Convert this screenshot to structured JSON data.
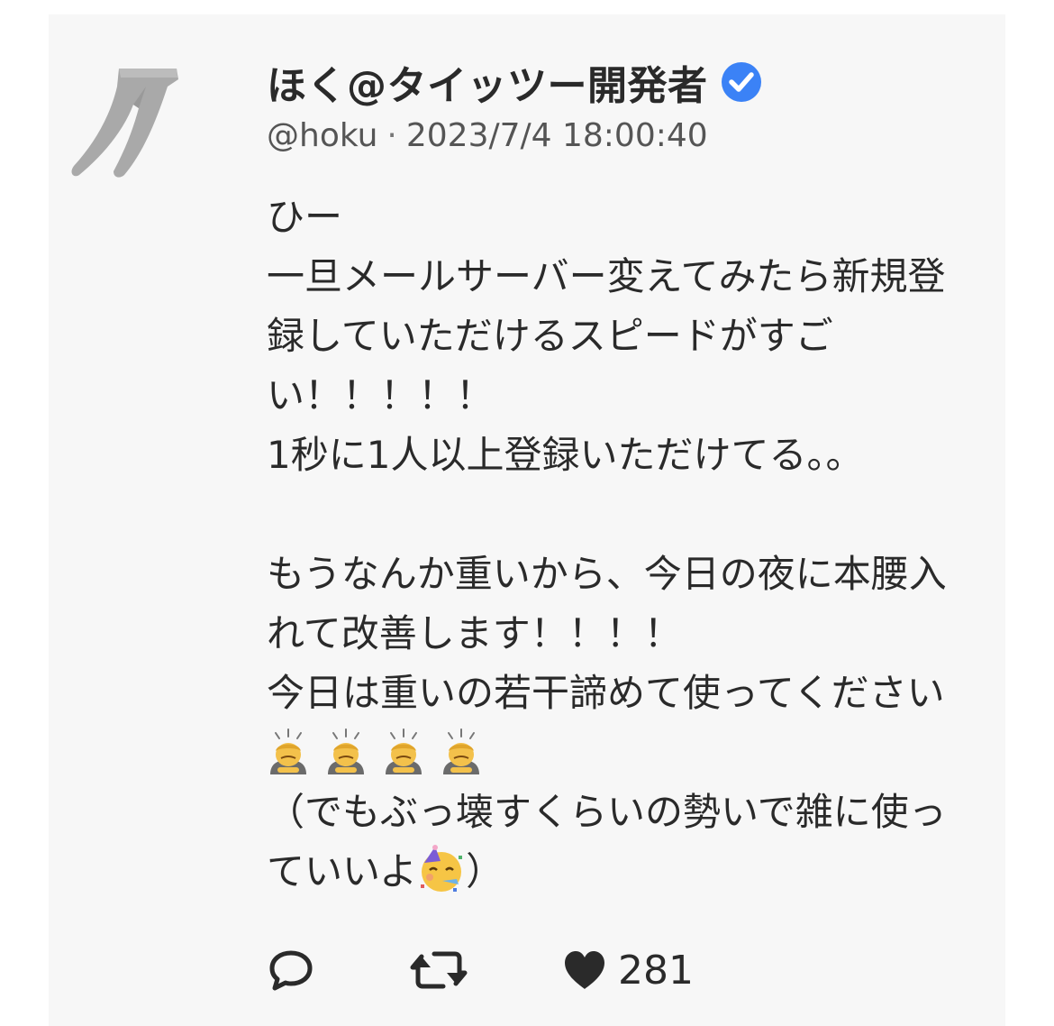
{
  "post": {
    "display_name": "ほく@タイッツー開発者",
    "verified_icon": "verified-check-icon",
    "handle": "@hoku",
    "separator": "·",
    "timestamp": "2023/7/4 18:00:40",
    "body_lines": [
      "ひー",
      "一旦メールサーバー変えてみたら新規登",
      "録していただけるスピードがすご",
      "い！！！！！",
      "1秒に1人以上登録いただけてる。。",
      "",
      "もうなんか重いから、今日の夜に本腰入",
      "れて改善します！！！！",
      "今日は重いの若干諦めて使ってください"
    ],
    "emoji_row": [
      "person-bowing-icon",
      "person-bowing-icon",
      "person-bowing-icon",
      "person-bowing-icon"
    ],
    "closing_line_1": "（でもぶっ壊すくらいの勢いで雑に使っ",
    "closing_line_2_text": "ていいよ",
    "closing_line_2_emoji": "partying-face-icon",
    "closing_line_2_end": "）"
  },
  "actions": {
    "reply_icon": "reply-icon",
    "retweet_icon": "retweet-icon",
    "like_icon": "heart-icon",
    "like_count": "281"
  },
  "colors": {
    "card_background": "#f7f7f7",
    "text": "#2a2a2a",
    "meta_text": "#555555",
    "verified_blue": "#3b82f6",
    "avatar_gray": "#a9a9a9"
  }
}
